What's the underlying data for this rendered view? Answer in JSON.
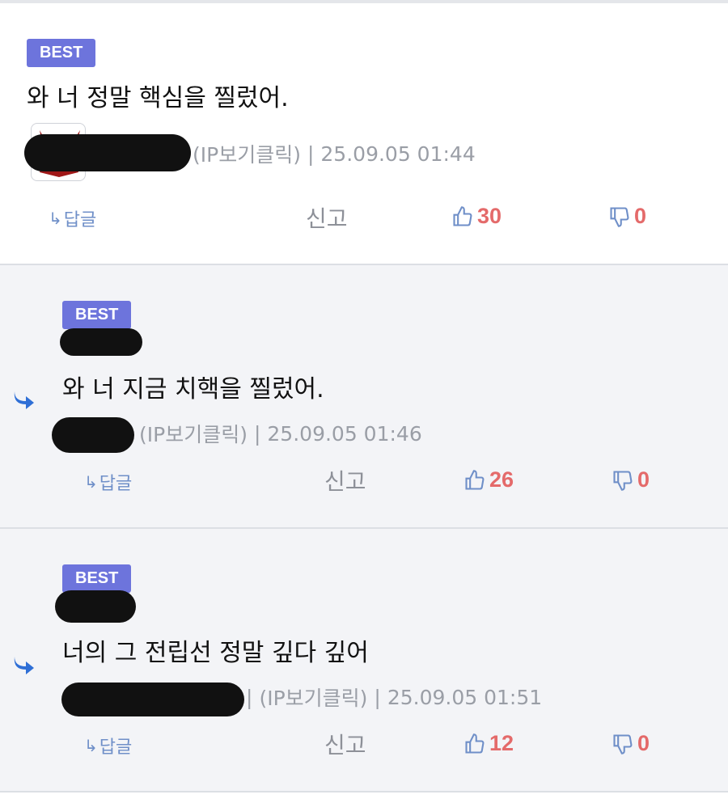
{
  "comments": [
    {
      "badge": "BEST",
      "text": "와 너 정말 핵심을 찔렀어.",
      "ip_link": "(IP보기클릭)",
      "datetime": "25.09.05 01:44",
      "reply_label": "답글",
      "report_label": "신고",
      "likes": "30",
      "dislikes": "0"
    },
    {
      "badge": "BEST",
      "text": "와 너 지금 치핵을 찔렀어.",
      "ip_link": "(IP보기클릭)",
      "datetime": "25.09.05 01:46",
      "reply_label": "답글",
      "report_label": "신고",
      "likes": "26",
      "dislikes": "0"
    },
    {
      "badge": "BEST",
      "text": "너의 그 전립선 정말 깊다 깊어",
      "ip_link": "(IP보기클릭)",
      "datetime": "25.09.05 01:51",
      "reply_label": "답글",
      "report_label": "신고",
      "likes": "12",
      "dislikes": "0"
    }
  ],
  "colors": {
    "badge": "#6d74dc",
    "like_count": "#e46a6a",
    "icon_blue": "#6f8fc8",
    "reply_arrow": "#2f6fd6"
  }
}
